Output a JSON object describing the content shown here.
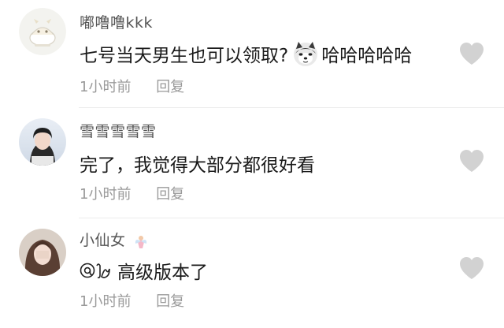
{
  "comments": [
    {
      "username": "嘟噜噜kkk",
      "text_before": "七号当天男生也可以领取?",
      "emoji_name": "husky-dog-emoji",
      "text_after": "哈哈哈哈哈",
      "time": "1小时前",
      "reply_label": "回复",
      "avatar_icon": "cartoon-avatar"
    },
    {
      "username": "雪雪雪雪雪",
      "text": "完了，我觉得大部分都很好看",
      "time": "1小时前",
      "reply_label": "回复",
      "avatar_icon": "photo-avatar"
    },
    {
      "username": "小仙女",
      "username_sticker": "fairy-sticker",
      "mention_icon": "mention-icon",
      "text": "高级版本了",
      "time": "1小时前",
      "reply_label": "回复",
      "avatar_icon": "photo-avatar"
    }
  ],
  "like_icon": "heart-icon",
  "colors": {
    "username": "#555555",
    "content": "#1a1a1a",
    "meta": "#9a9a9a",
    "heart": "#d2d2d2"
  }
}
